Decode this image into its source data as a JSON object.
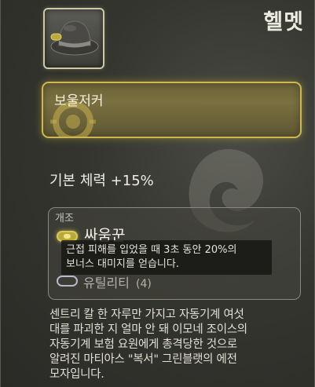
{
  "item": {
    "type_label": "헬멧",
    "icon": "bowler-hat-icon"
  },
  "set_header": {
    "name": "보울저커",
    "emblem": "gear-emblem-icon",
    "color": "#cdb654"
  },
  "stats": {
    "base_line": "기본 체력 +15%"
  },
  "mods": {
    "title": "개조",
    "active": {
      "name": "싸움꾼",
      "description_lines": [
        "근접 피해를 입었을 때 3초 동안 20%의",
        "보너스 대미지를 얻습니다."
      ],
      "gem_color": "#d9c75a"
    },
    "empty_slot": {
      "name": "유틸리티",
      "count": "(4)"
    }
  },
  "flavor_lines": [
    "센트리 칼 한 자루만 가지고 자동기계 여섯",
    "대를 파괴한 지 얼마 안 돼 이모네 조이스의",
    "자동기계 보험 요원에게 총격당한 것으로",
    "알려진 마티아스 \"복서\" 그린블랫의 에전",
    "모자입니다."
  ]
}
